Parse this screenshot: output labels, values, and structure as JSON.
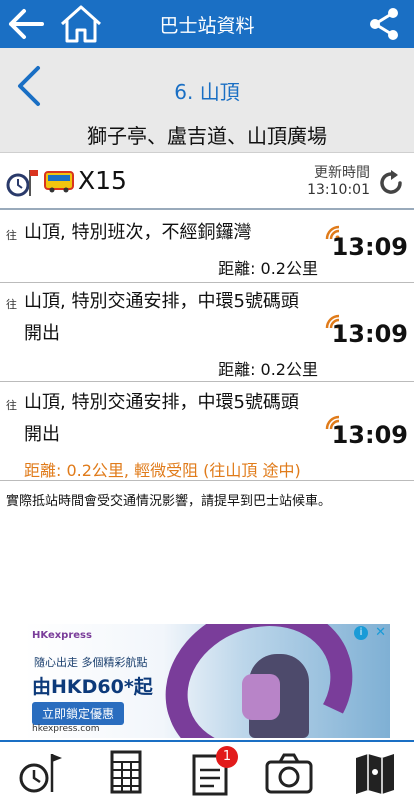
{
  "appbar": {
    "title": "巴士站資料",
    "icons": [
      "back-arrow-icon",
      "home-icon",
      "share-icon"
    ]
  },
  "stop": {
    "name": "6. 山頂",
    "road": "獅子亭、盧吉道、山頂廣場"
  },
  "route": {
    "number": "X15",
    "update_label": "更新時間",
    "update_time": "13:10:01"
  },
  "etas": [
    {
      "to": "往",
      "destination": "山頂, 特別班次，不經銅鑼灣",
      "distance": "距離: 0.2公里",
      "time": "13:09",
      "warning": false
    },
    {
      "to": "往",
      "destination": "山頂, 特別交通安排，中環5號碼頭開出",
      "distance": "距離: 0.2公里",
      "time": "13:09",
      "warning": false
    },
    {
      "to": "往",
      "destination": "山頂, 特別交通安排，中環5號碼頭開出",
      "distance": "距離: 0.2公里, 輕微受阻 (往山頂 途中)",
      "time": "13:09",
      "warning": true
    }
  ],
  "notice": "實際抵站時間會受交通情況影響，請提早到巴士站候車。",
  "ad": {
    "brand": "HKexpress",
    "line1": "隨心出走 多個精彩航點",
    "price": "由HKD60*起",
    "cta": "立即鎖定優惠",
    "url": "hkexpress.com",
    "info": "i",
    "close": "✕"
  },
  "bottombar": {
    "badge_count": "1",
    "tabs": [
      "clock-flag-icon",
      "timetable-icon",
      "notice-icon",
      "camera-icon",
      "map-icon"
    ]
  },
  "colors": {
    "primary": "#1a6fc4",
    "warning": "#e07b1a",
    "badge": "#e21b1b"
  }
}
